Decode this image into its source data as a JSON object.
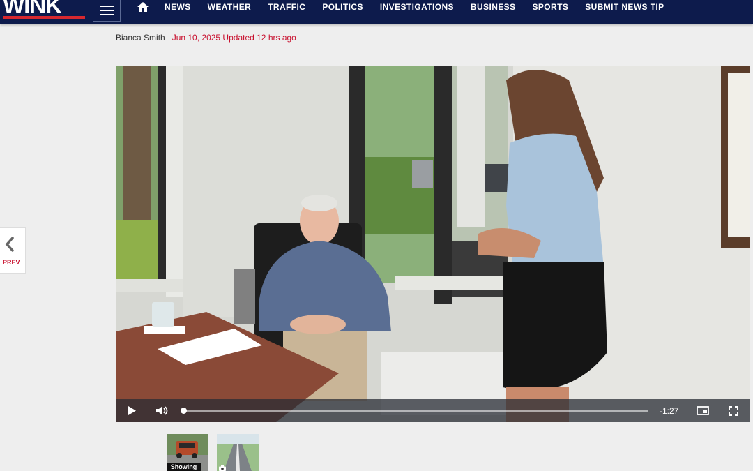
{
  "header": {
    "logo_text": "WINK",
    "nav_items": [
      "NEWS",
      "WEATHER",
      "TRAFFIC",
      "POLITICS",
      "INVESTIGATIONS",
      "BUSINESS",
      "SPORTS",
      "SUBMIT NEWS TIP"
    ],
    "icons": [
      "hamburger-menu-icon",
      "home-icon"
    ],
    "colors": {
      "nav_bg": "#0d1b4c",
      "accent_red": "#d7282f"
    }
  },
  "article": {
    "author": "Bianca Smith",
    "dates": "Jun 10, 2025 Updated 12 hrs ago"
  },
  "player": {
    "time_remaining": "-1:27",
    "progress": 0.0,
    "icons": [
      "play-icon",
      "volume-icon",
      "picture-in-picture-icon",
      "fullscreen-icon"
    ]
  },
  "prev": {
    "label": "PREV"
  },
  "thumbnails": [
    {
      "badge": "Showing"
    },
    {
      "badge_icon": "camera-icon"
    }
  ]
}
